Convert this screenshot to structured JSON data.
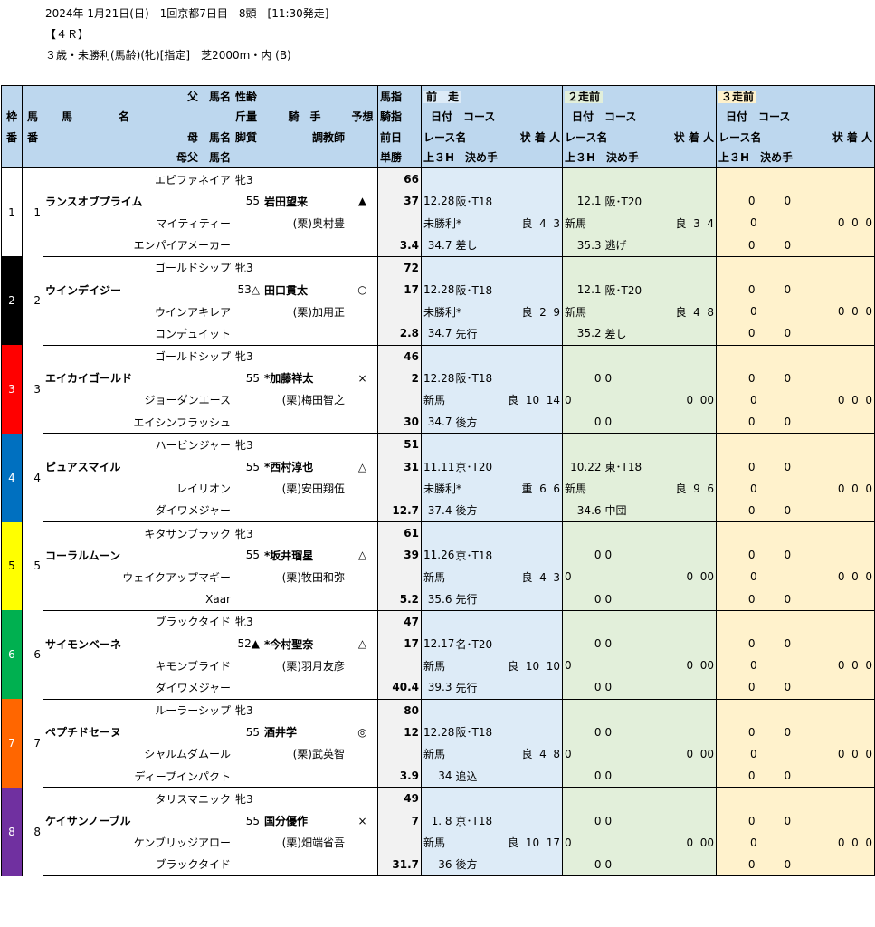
{
  "header": {
    "line1": "2024年 1月21日(日)　1回京都7日目　8頭　[11:30発走]",
    "line2": "【４Ｒ】",
    "line3": "３歳・未勝利(馬齢)(牝)[指定]　芝2000m・内 (B)"
  },
  "columns": {
    "waku": [
      "枠",
      "番"
    ],
    "umaban": [
      "馬",
      "番"
    ],
    "uma_top": "父　馬名",
    "uma_mid_left": "馬",
    "uma_mid_right": "名",
    "uma_mother": "母　馬名",
    "uma_bms": "母父　馬名",
    "seirei": [
      "性齢",
      "斤量",
      "脚質"
    ],
    "kishu": "騎　手",
    "choukyoushi": "調教師",
    "yosou": "予想",
    "shisu": [
      "馬指",
      "騎指",
      "前日",
      "単勝"
    ],
    "prev1": "前　走",
    "prev2": "２走前",
    "prev3": "３走前",
    "date_course": "日付　コース",
    "race_name": "レース名",
    "result": "状 着 人",
    "last3f": "上３H　決め手"
  },
  "colors": {
    "frames": [
      "#ffffff",
      "#000000",
      "#ff0000",
      "#0070c0",
      "#ffff00",
      "#00b050",
      "#ff6600",
      "#7030a0"
    ],
    "frame_text": [
      "#000000",
      "#ffffff",
      "#ffffff",
      "#ffffff",
      "#000000",
      "#ffffff",
      "#ffffff",
      "#ffffff"
    ]
  },
  "horses": [
    {
      "waku": "1",
      "umaban": "1",
      "sire": "エピファネイア",
      "name": "ランスオブプライム",
      "dam": "マイティティー",
      "bms": "エンパイアメーカー",
      "sexage": "牝3",
      "weight": "55",
      "jockey": "岩田望来",
      "trainer": "(栗)奥村豊",
      "mark": "▲",
      "uma_idx": "66",
      "kishu_idx": "37",
      "zenjitsu": "",
      "tansho": "3.4",
      "p1": {
        "date": "12.28",
        "course": "阪･T18",
        "race": "未勝利*",
        "cond": "良",
        "pos": "4",
        "pop": "3",
        "f3": "34.7",
        "style": "差し"
      },
      "p2": {
        "date": "12.1",
        "course": "阪･T20",
        "race": "新馬",
        "cond": "良",
        "pos": "3",
        "pop": "4",
        "f3": "35.3",
        "style": "逃げ"
      },
      "p3": {
        "date": "0",
        "course": "0",
        "race": "0",
        "cond": "",
        "pos": "0",
        "pop": "0",
        "ex": "0",
        "f3": "0",
        "style": "0"
      }
    },
    {
      "waku": "2",
      "umaban": "2",
      "sire": "ゴールドシップ",
      "name": "ウインデイジー",
      "dam": "ウインアキレア",
      "bms": "コンデュイット",
      "sexage": "牝3",
      "weight": "53△",
      "jockey": "田口貫太",
      "trainer": "(栗)加用正",
      "mark": "○",
      "uma_idx": "72",
      "kishu_idx": "17",
      "zenjitsu": "",
      "tansho": "2.8",
      "p1": {
        "date": "12.28",
        "course": "阪･T18",
        "race": "未勝利*",
        "cond": "良",
        "pos": "2",
        "pop": "9",
        "f3": "34.7",
        "style": "先行"
      },
      "p2": {
        "date": "12.1",
        "course": "阪･T20",
        "race": "新馬",
        "cond": "良",
        "pos": "4",
        "pop": "8",
        "f3": "35.2",
        "style": "差し"
      },
      "p3": {
        "date": "0",
        "course": "0",
        "race": "0",
        "cond": "",
        "pos": "0",
        "pop": "0",
        "ex": "0",
        "f3": "0",
        "style": "0"
      }
    },
    {
      "waku": "3",
      "umaban": "3",
      "sire": "ゴールドシップ",
      "name": "エイカイゴールド",
      "dam": "ジョーダンエース",
      "bms": "エイシンフラッシュ",
      "sexage": "牝3",
      "weight": "55",
      "jockey": "*加藤祥太",
      "trainer": "(栗)梅田智之",
      "mark": "×",
      "uma_idx": "46",
      "kishu_idx": "2",
      "zenjitsu": "",
      "tansho": "30",
      "p1": {
        "date": "12.28",
        "course": "阪･T18",
        "race": "新馬",
        "cond": "良",
        "pos": "10",
        "pop": "14",
        "f3": "34.7",
        "style": "後方"
      },
      "p2": {
        "date": "0",
        "course": "0",
        "race": "0",
        "cond": "",
        "pos": "0",
        "pop": "0",
        "ex": "0",
        "f3": "0",
        "style": "0"
      },
      "p3": {
        "date": "0",
        "course": "0",
        "race": "0",
        "cond": "",
        "pos": "0",
        "pop": "0",
        "ex": "0",
        "f3": "0",
        "style": "0"
      }
    },
    {
      "waku": "4",
      "umaban": "4",
      "sire": "ハービンジャー",
      "name": "ピュアスマイル",
      "dam": "レイリオン",
      "bms": "ダイワメジャー",
      "sexage": "牝3",
      "weight": "55",
      "jockey": "*西村淳也",
      "trainer": "(栗)安田翔伍",
      "mark": "△",
      "uma_idx": "51",
      "kishu_idx": "31",
      "zenjitsu": "",
      "tansho": "12.7",
      "p1": {
        "date": "11.11",
        "course": "京･T20",
        "race": "未勝利*",
        "cond": "重",
        "pos": "6",
        "pop": "6",
        "f3": "37.4",
        "style": "後方"
      },
      "p2": {
        "date": "10.22",
        "course": "東･T18",
        "race": "新馬",
        "cond": "良",
        "pos": "9",
        "pop": "6",
        "f3": "34.6",
        "style": "中団"
      },
      "p3": {
        "date": "0",
        "course": "0",
        "race": "0",
        "cond": "",
        "pos": "0",
        "pop": "0",
        "ex": "0",
        "f3": "0",
        "style": "0"
      }
    },
    {
      "waku": "5",
      "umaban": "5",
      "sire": "キタサンブラック",
      "name": "コーラルムーン",
      "dam": "ウェイクアップマギー",
      "bms": "Xaar",
      "sexage": "牝3",
      "weight": "55",
      "jockey": "*坂井瑠星",
      "trainer": "(栗)牧田和弥",
      "mark": "△",
      "uma_idx": "61",
      "kishu_idx": "39",
      "zenjitsu": "",
      "tansho": "5.2",
      "p1": {
        "date": "11.26",
        "course": "京･T18",
        "race": "新馬",
        "cond": "良",
        "pos": "4",
        "pop": "3",
        "f3": "35.6",
        "style": "先行"
      },
      "p2": {
        "date": "0",
        "course": "0",
        "race": "0",
        "cond": "",
        "pos": "0",
        "pop": "0",
        "ex": "0",
        "f3": "0",
        "style": "0"
      },
      "p3": {
        "date": "0",
        "course": "0",
        "race": "0",
        "cond": "",
        "pos": "0",
        "pop": "0",
        "ex": "0",
        "f3": "0",
        "style": "0"
      }
    },
    {
      "waku": "6",
      "umaban": "6",
      "sire": "ブラックタイド",
      "name": "サイモンベーネ",
      "dam": "キモンブライド",
      "bms": "ダイワメジャー",
      "sexage": "牝3",
      "weight": "52▲",
      "jockey": "*今村聖奈",
      "trainer": "(栗)羽月友彦",
      "mark": "△",
      "uma_idx": "47",
      "kishu_idx": "17",
      "zenjitsu": "",
      "tansho": "40.4",
      "p1": {
        "date": "12.17",
        "course": "名･T20",
        "race": "新馬",
        "cond": "良",
        "pos": "10",
        "pop": "10",
        "f3": "39.3",
        "style": "先行"
      },
      "p2": {
        "date": "0",
        "course": "0",
        "race": "0",
        "cond": "",
        "pos": "0",
        "pop": "0",
        "ex": "0",
        "f3": "0",
        "style": "0"
      },
      "p3": {
        "date": "0",
        "course": "0",
        "race": "0",
        "cond": "",
        "pos": "0",
        "pop": "0",
        "ex": "0",
        "f3": "0",
        "style": "0"
      }
    },
    {
      "waku": "7",
      "umaban": "7",
      "sire": "ルーラーシップ",
      "name": "ペプチドセーヌ",
      "dam": "シャルムダムール",
      "bms": "ディープインパクト",
      "sexage": "牝3",
      "weight": "55",
      "jockey": "酒井学",
      "trainer": "(栗)武英智",
      "mark": "◎",
      "uma_idx": "80",
      "kishu_idx": "12",
      "zenjitsu": "",
      "tansho": "3.9",
      "p1": {
        "date": "12.28",
        "course": "阪･T18",
        "race": "新馬",
        "cond": "良",
        "pos": "4",
        "pop": "8",
        "f3": "34",
        "style": "追込"
      },
      "p2": {
        "date": "0",
        "course": "0",
        "race": "0",
        "cond": "",
        "pos": "0",
        "pop": "0",
        "ex": "0",
        "f3": "0",
        "style": "0"
      },
      "p3": {
        "date": "0",
        "course": "0",
        "race": "0",
        "cond": "",
        "pos": "0",
        "pop": "0",
        "ex": "0",
        "f3": "0",
        "style": "0"
      }
    },
    {
      "waku": "8",
      "umaban": "8",
      "sire": "タリスマニック",
      "name": "ケイサンノーブル",
      "dam": "ケンブリッジアロー",
      "bms": "ブラックタイド",
      "sexage": "牝3",
      "weight": "55",
      "jockey": "国分優作",
      "trainer": "(栗)畑端省吾",
      "mark": "×",
      "uma_idx": "49",
      "kishu_idx": "7",
      "zenjitsu": "",
      "tansho": "31.7",
      "p1": {
        "date": "1. 8",
        "course": "京･T18",
        "race": "新馬",
        "cond": "良",
        "pos": "10",
        "pop": "17",
        "f3": "36",
        "style": "後方"
      },
      "p2": {
        "date": "0",
        "course": "0",
        "race": "0",
        "cond": "",
        "pos": "0",
        "pop": "0",
        "ex": "0",
        "f3": "0",
        "style": "0"
      },
      "p3": {
        "date": "0",
        "course": "0",
        "race": "0",
        "cond": "",
        "pos": "0",
        "pop": "0",
        "ex": "0",
        "f3": "0",
        "style": "0"
      }
    }
  ]
}
